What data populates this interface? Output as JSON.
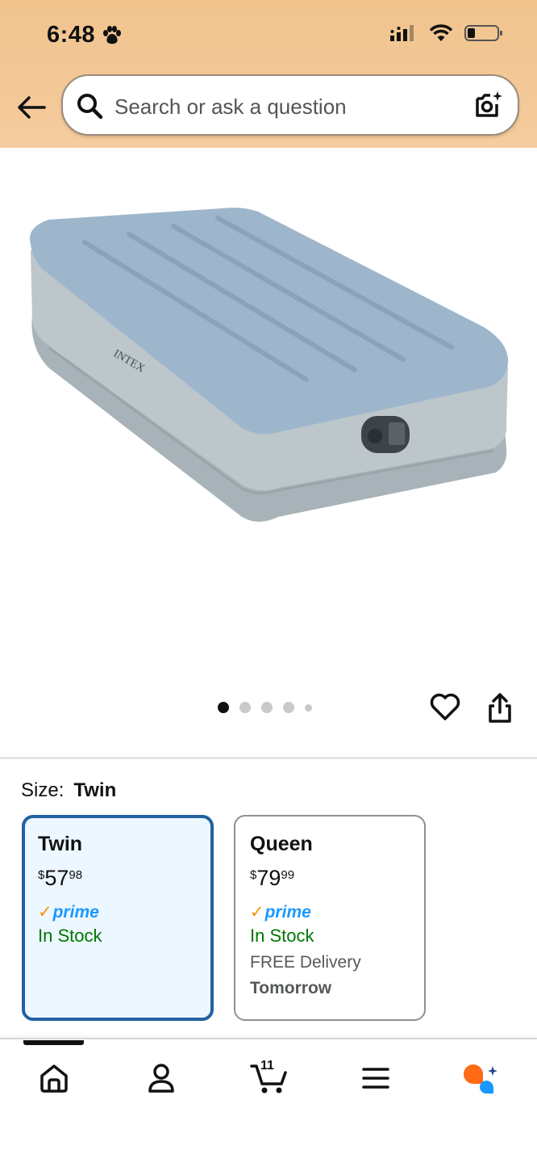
{
  "status": {
    "time": "6:48"
  },
  "search": {
    "placeholder": "Search or ask a question"
  },
  "product": {
    "image_brand": "INTEX",
    "image_count": 5,
    "active_image": 1
  },
  "size": {
    "label": "Size:",
    "selected": "Twin",
    "options": [
      {
        "name": "Twin",
        "price_symbol": "$",
        "price_whole": "57",
        "price_cents": "98",
        "prime": "prime",
        "stock": "In Stock"
      },
      {
        "name": "Queen",
        "price_symbol": "$",
        "price_whole": "79",
        "price_cents": "99",
        "prime": "prime",
        "stock": "In Stock",
        "delivery": "FREE Delivery",
        "delivery_when": "Tomorrow"
      }
    ]
  },
  "nav": {
    "cart_count": "11",
    "items": [
      "home-icon",
      "account-icon",
      "cart-icon",
      "menu-icon",
      "rufus-icon"
    ]
  },
  "colors": {
    "header": "#f3c897",
    "selected_border": "#2162a1",
    "selected_bg": "#edf7ff",
    "in_stock": "#007600",
    "prime_blue": "#1a98ff",
    "prime_check": "#f79400"
  }
}
